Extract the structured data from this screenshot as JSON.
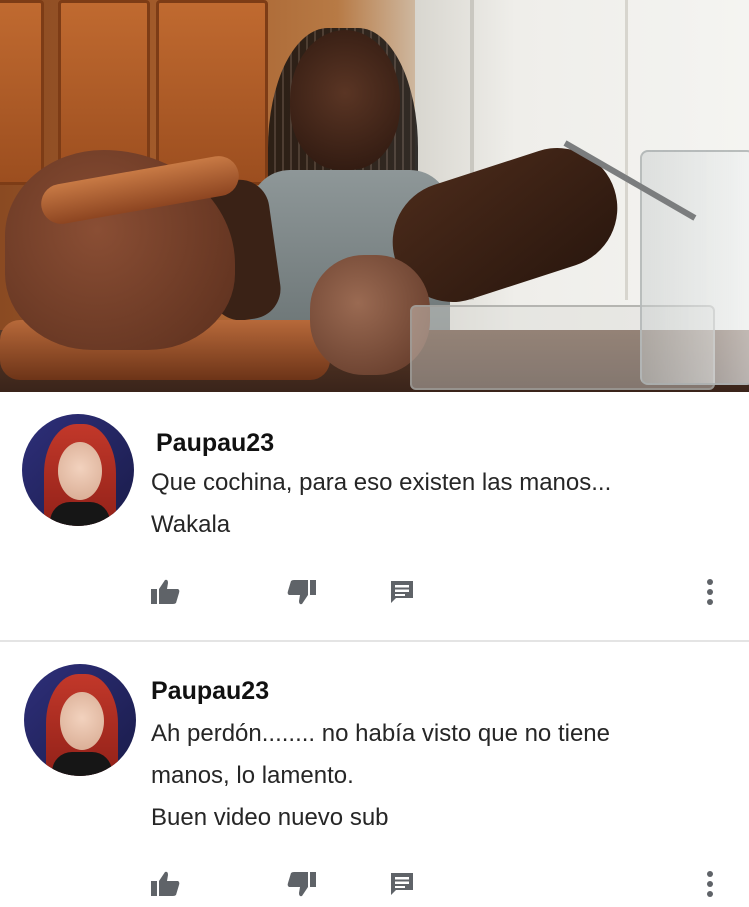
{
  "comments": [
    {
      "username": "Paupau23",
      "lines": [
        "Que cochina, para eso existen las manos...",
        "Wakala"
      ]
    },
    {
      "username": "Paupau23",
      "lines": [
        "Ah perdón........ no había visto que no tiene",
        "manos, lo lamento.",
        "Buen video nuevo sub"
      ]
    }
  ],
  "icons": {
    "like": "thumbs-up-icon",
    "dislike": "thumbs-down-icon",
    "reply": "reply-comment-icon",
    "more": "more-vertical-icon"
  },
  "colors": {
    "icon": "#5f6368",
    "text": "#262626",
    "username": "#111111"
  }
}
